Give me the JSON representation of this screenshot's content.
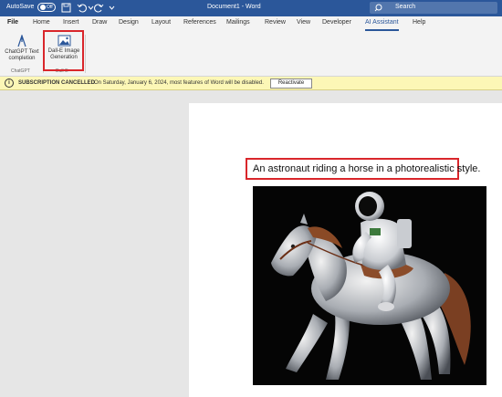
{
  "titlebar": {
    "autosave_label": "AutoSave",
    "autosave_state": "Off",
    "doc_title": "Document1 - Word",
    "search_placeholder": "Search"
  },
  "tabs": [
    "File",
    "Home",
    "Insert",
    "Draw",
    "Design",
    "Layout",
    "References",
    "Mailings",
    "Review",
    "View",
    "Developer",
    "AI Assistant",
    "Help"
  ],
  "active_tab": "AI Assistant",
  "ribbon": {
    "chatgpt_button_line1": "ChatGPT Text",
    "chatgpt_button_line2": "completion",
    "chatgpt_group": "ChatGPT",
    "dalle_button_line1": "Dall-E Image",
    "dalle_button_line2": "Generation",
    "dalle_group": "Dall-E"
  },
  "message_bar": {
    "title": "SUBSCRIPTION CANCELLED",
    "message": "On Saturday, January 6, 2024, most features of Word will be disabled.",
    "button": "Reactivate"
  },
  "document": {
    "prompt": "An astronaut riding a horse in a photorealistic style."
  },
  "colors": {
    "title_bar": "#2b579a",
    "highlight": "#d9262b",
    "message_bar": "#fcf7b6"
  }
}
